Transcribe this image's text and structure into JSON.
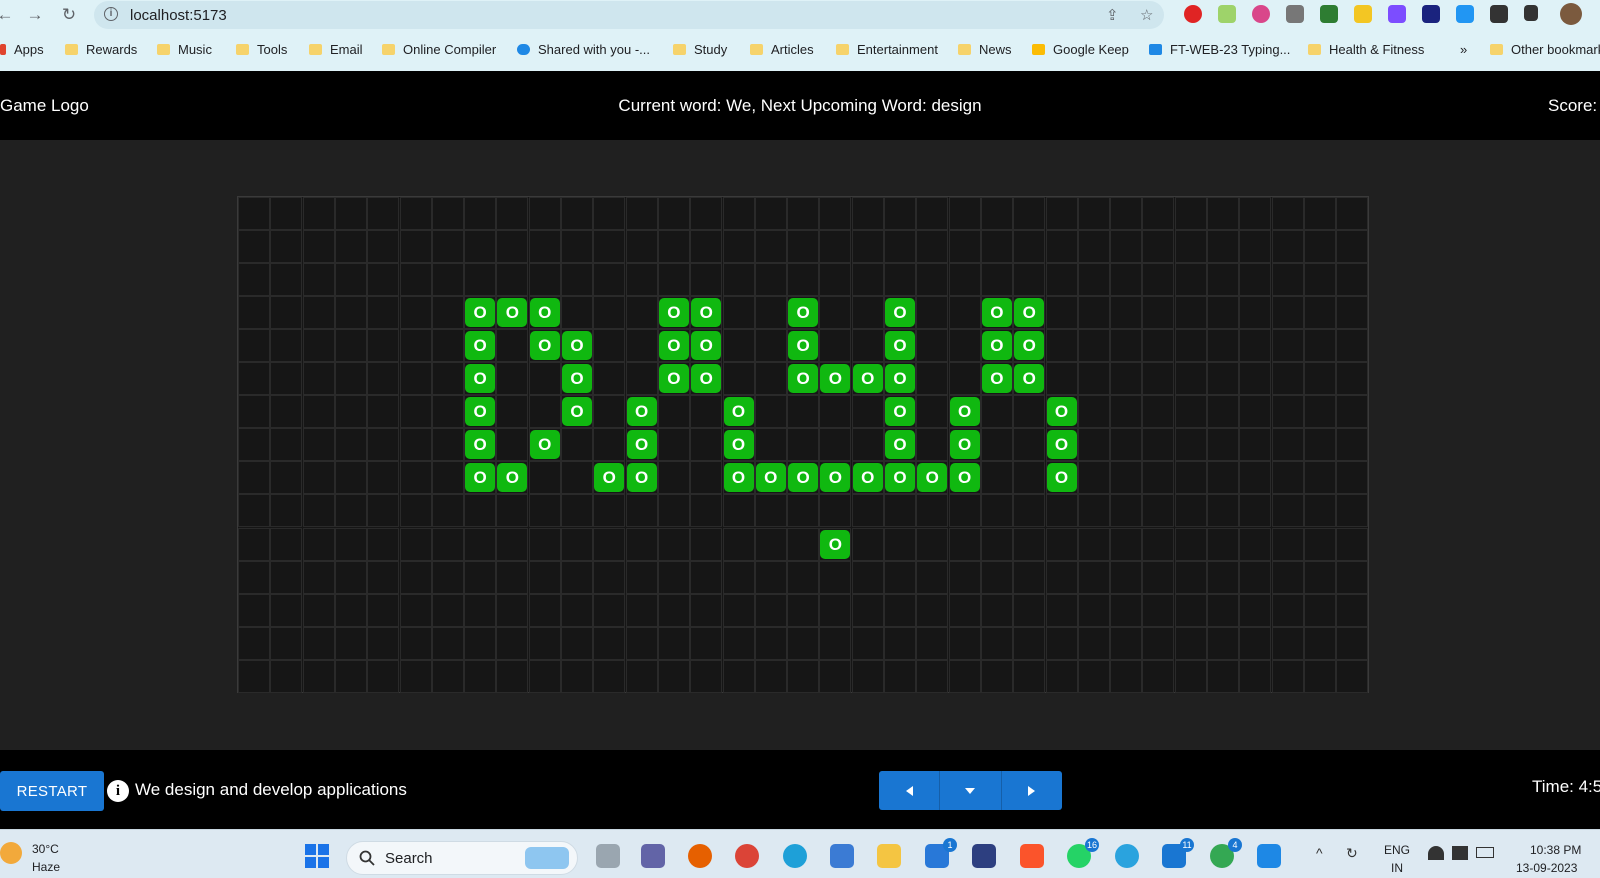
{
  "browser": {
    "url": "localhost:5173",
    "bookmarks": [
      "Apps",
      "Rewards",
      "Music",
      "Tools",
      "Email",
      "Online Compiler",
      "Shared with you -...",
      "Study",
      "Articles",
      "Entertainment",
      "News",
      "Google Keep",
      "FT-WEB-23 Typing...",
      "Health & Fitness",
      "»",
      "Other bookmarks"
    ]
  },
  "header": {
    "logo": "Game Logo",
    "word_info": "Current word: We, Next Upcoming Word: design",
    "score_label": "Score:"
  },
  "board": {
    "columns": 35,
    "rows": 15,
    "cell_color": "#161616",
    "token_color": "#10b810",
    "token_label": "O",
    "tokens": [
      [
        3,
        7
      ],
      [
        3,
        8
      ],
      [
        3,
        9
      ],
      [
        3,
        13
      ],
      [
        3,
        14
      ],
      [
        3,
        17
      ],
      [
        3,
        20
      ],
      [
        3,
        23
      ],
      [
        3,
        24
      ],
      [
        4,
        7
      ],
      [
        4,
        9
      ],
      [
        4,
        10
      ],
      [
        4,
        13
      ],
      [
        4,
        14
      ],
      [
        4,
        17
      ],
      [
        4,
        20
      ],
      [
        4,
        23
      ],
      [
        4,
        24
      ],
      [
        5,
        7
      ],
      [
        5,
        10
      ],
      [
        5,
        13
      ],
      [
        5,
        14
      ],
      [
        5,
        17
      ],
      [
        5,
        18
      ],
      [
        5,
        19
      ],
      [
        5,
        20
      ],
      [
        5,
        23
      ],
      [
        5,
        24
      ],
      [
        6,
        7
      ],
      [
        6,
        10
      ],
      [
        6,
        12
      ],
      [
        6,
        15
      ],
      [
        6,
        20
      ],
      [
        6,
        22
      ],
      [
        6,
        25
      ],
      [
        7,
        7
      ],
      [
        7,
        9
      ],
      [
        7,
        12
      ],
      [
        7,
        15
      ],
      [
        7,
        20
      ],
      [
        7,
        22
      ],
      [
        7,
        25
      ],
      [
        8,
        7
      ],
      [
        8,
        8
      ],
      [
        8,
        11
      ],
      [
        8,
        12
      ],
      [
        8,
        15
      ],
      [
        8,
        16
      ],
      [
        8,
        17
      ],
      [
        8,
        18
      ],
      [
        8,
        19
      ],
      [
        8,
        20
      ],
      [
        8,
        21
      ],
      [
        8,
        22
      ],
      [
        8,
        25
      ],
      [
        10,
        18
      ]
    ]
  },
  "footer": {
    "restart_label": "RESTART",
    "sentence": "We design and develop applications",
    "timer": "Time: 4:5"
  },
  "taskbar": {
    "weather_temp": "30°C",
    "weather_cond": "Haze",
    "search_label": "Search",
    "badges": {
      "teams": "1",
      "whatsapp": "16",
      "vscode": "11",
      "chrome": "4"
    },
    "lang_line1": "ENG",
    "lang_line2": "IN",
    "time": "10:38 PM",
    "date": "13-09-2023"
  }
}
